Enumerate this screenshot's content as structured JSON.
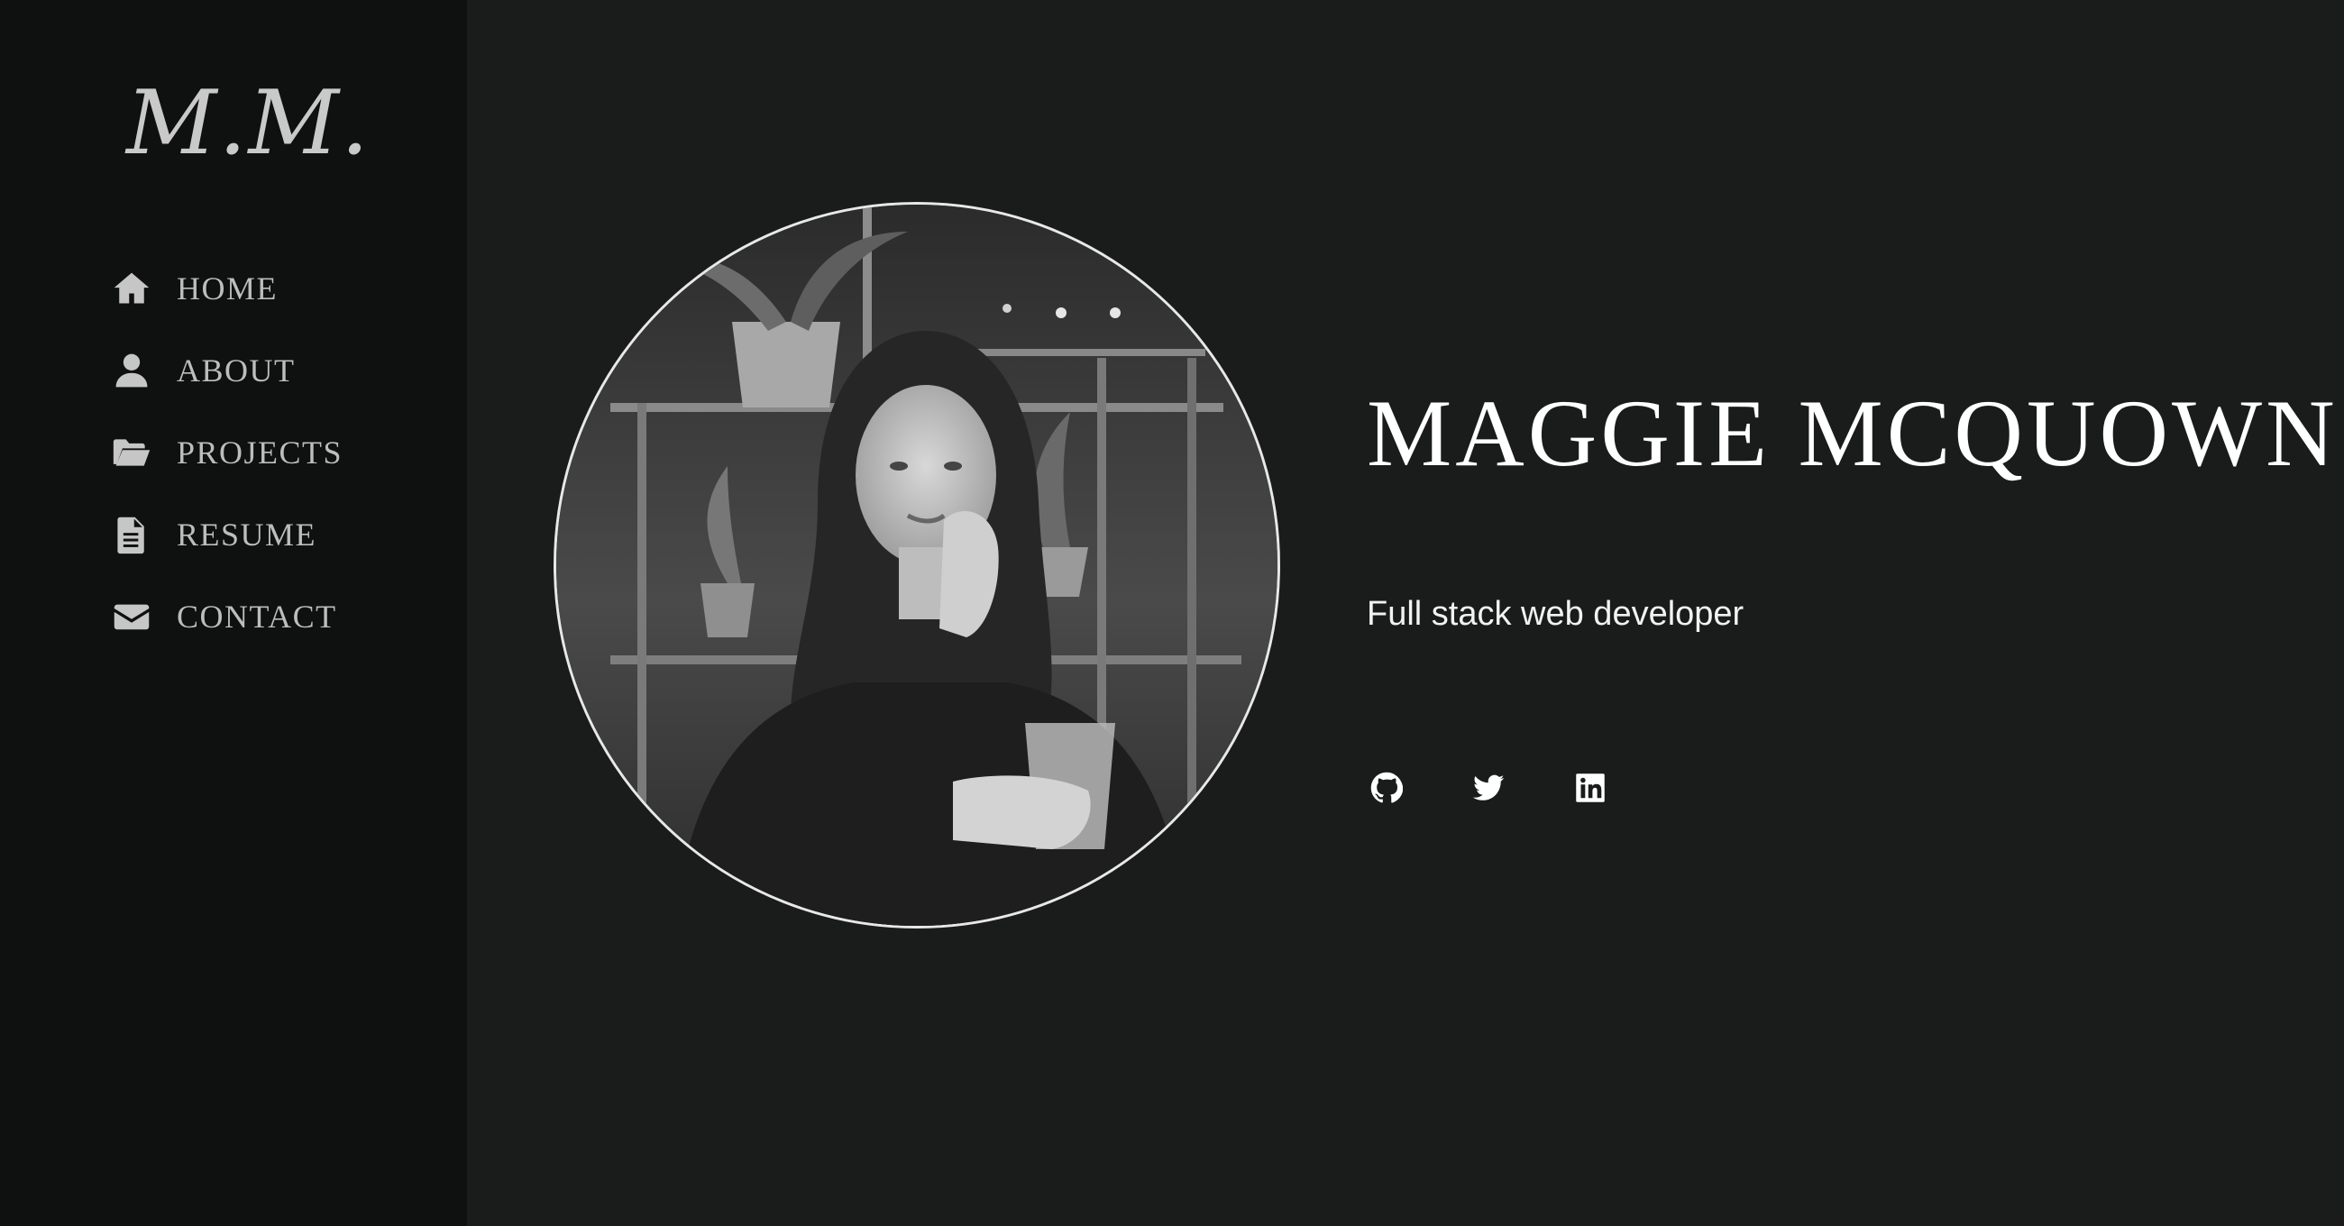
{
  "sidebar": {
    "logo": "M.M.",
    "items": [
      {
        "label": "HOME",
        "icon": "home-icon"
      },
      {
        "label": "ABOUT",
        "icon": "user-icon"
      },
      {
        "label": "PROJECTS",
        "icon": "folder-open-icon"
      },
      {
        "label": "RESUME",
        "icon": "file-text-icon"
      },
      {
        "label": "CONTACT",
        "icon": "envelope-icon"
      }
    ]
  },
  "hero": {
    "name": "MAGGIE MCQUOWN",
    "tagline": "Full stack web developer",
    "photo": "profile-photo",
    "socials": [
      {
        "name": "github",
        "icon": "github-icon"
      },
      {
        "name": "twitter",
        "icon": "twitter-icon"
      },
      {
        "name": "linkedin",
        "icon": "linkedin-icon"
      }
    ]
  },
  "colors": {
    "page_background": "#1a1b1b",
    "sidebar_background": "#0f1010",
    "nav_text": "#bdbdbd",
    "heading_text": "#ffffff"
  }
}
